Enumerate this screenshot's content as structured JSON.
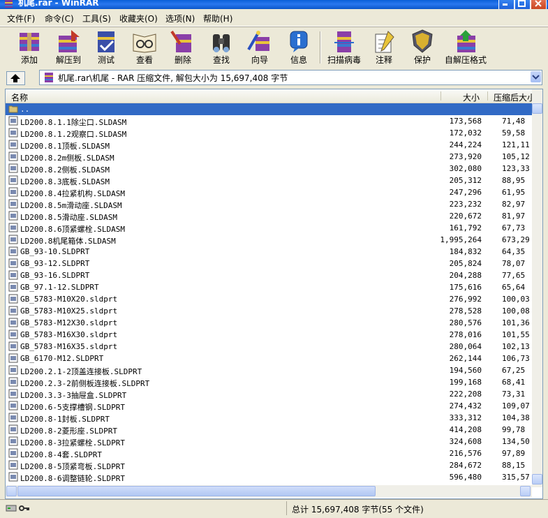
{
  "window": {
    "title": "机尾.rar - WinRAR"
  },
  "menu": [
    "文件(F)",
    "命令(C)",
    "工具(S)",
    "收藏夹(O)",
    "选项(N)",
    "帮助(H)"
  ],
  "toolbar": [
    {
      "label": "添加",
      "icon": "add-icon"
    },
    {
      "label": "解压到",
      "icon": "extract-icon"
    },
    {
      "label": "测试",
      "icon": "test-icon"
    },
    {
      "label": "查看",
      "icon": "view-icon"
    },
    {
      "label": "删除",
      "icon": "delete-icon"
    },
    {
      "label": "查找",
      "icon": "find-icon"
    },
    {
      "label": "向导",
      "icon": "wizard-icon"
    },
    {
      "label": "信息",
      "icon": "info-icon"
    },
    {
      "label": "扫描病毒",
      "icon": "virus-scan-icon"
    },
    {
      "label": "注释",
      "icon": "comment-icon"
    },
    {
      "label": "保护",
      "icon": "protect-icon"
    },
    {
      "label": "自解压格式",
      "icon": "sfx-icon"
    }
  ],
  "address": {
    "path": "机尾.rar\\机尾 - RAR 压缩文件, 解包大小为 15,697,408 字节"
  },
  "columns": {
    "name": "名称",
    "size": "大小",
    "packed": "压缩后大小"
  },
  "files": [
    {
      "name": "..",
      "size": "",
      "packed": ""
    },
    {
      "name": "LD200.8.1.1除尘口.SLDASM",
      "size": "173,568",
      "packed": "71,48"
    },
    {
      "name": "LD200.8.1.2观察口.SLDASM",
      "size": "172,032",
      "packed": "59,58"
    },
    {
      "name": "LD200.8.1顶板.SLDASM",
      "size": "244,224",
      "packed": "121,11"
    },
    {
      "name": "LD200.8.2m侧板.SLDASM",
      "size": "273,920",
      "packed": "105,12"
    },
    {
      "name": "LD200.8.2侧板.SLDASM",
      "size": "302,080",
      "packed": "123,33"
    },
    {
      "name": "LD200.8.3底板.SLDASM",
      "size": "205,312",
      "packed": "88,95"
    },
    {
      "name": "LD200.8.4拉紧机构.SLDASM",
      "size": "247,296",
      "packed": "61,95"
    },
    {
      "name": "LD200.8.5m滑动座.SLDASM",
      "size": "223,232",
      "packed": "82,97"
    },
    {
      "name": "LD200.8.5滑动座.SLDASM",
      "size": "220,672",
      "packed": "81,97"
    },
    {
      "name": "LD200.8.6顶紧螺栓.SLDASM",
      "size": "161,792",
      "packed": "67,73"
    },
    {
      "name": "LD200.8机尾箱体.SLDASM",
      "size": "1,995,264",
      "packed": "673,29"
    },
    {
      "name": "GB_93-10.SLDPRT",
      "size": "184,832",
      "packed": "64,35"
    },
    {
      "name": "GB_93-12.SLDPRT",
      "size": "205,824",
      "packed": "78,07"
    },
    {
      "name": "GB_93-16.SLDPRT",
      "size": "204,288",
      "packed": "77,65"
    },
    {
      "name": "GB_97.1-12.SLDPRT",
      "size": "175,616",
      "packed": "65,64"
    },
    {
      "name": "GB_5783-M10X20.sldprt",
      "size": "276,992",
      "packed": "100,03"
    },
    {
      "name": "GB_5783-M10X25.sldprt",
      "size": "278,528",
      "packed": "100,08"
    },
    {
      "name": "GB_5783-M12X30.sldprt",
      "size": "280,576",
      "packed": "101,36"
    },
    {
      "name": "GB_5783-M16X30.sldprt",
      "size": "278,016",
      "packed": "101,55"
    },
    {
      "name": "GB_5783-M16X35.sldprt",
      "size": "280,064",
      "packed": "102,13"
    },
    {
      "name": "GB_6170-M12.SLDPRT",
      "size": "262,144",
      "packed": "106,73"
    },
    {
      "name": "LD200.2.1-2顶盖连接板.SLDPRT",
      "size": "194,560",
      "packed": "67,25"
    },
    {
      "name": "LD200.2.3-2前侧板连接板.SLDPRT",
      "size": "199,168",
      "packed": "68,41"
    },
    {
      "name": "LD200.3.3-3抽屉盒.SLDPRT",
      "size": "222,208",
      "packed": "73,31"
    },
    {
      "name": "LD200.6-5支撑槽钢.SLDPRT",
      "size": "274,432",
      "packed": "109,07"
    },
    {
      "name": "LD200.8-1封板.SLDPRT",
      "size": "333,312",
      "packed": "104,38"
    },
    {
      "name": "LD200.8-2菱形座.SLDPRT",
      "size": "414,208",
      "packed": "99,78"
    },
    {
      "name": "LD200.8-3拉紧螺栓.SLDPRT",
      "size": "324,608",
      "packed": "134,50"
    },
    {
      "name": "LD200.8-4套.SLDPRT",
      "size": "216,576",
      "packed": "97,89"
    },
    {
      "name": "LD200.8-5顶紧弯板.SLDPRT",
      "size": "284,672",
      "packed": "88,15"
    },
    {
      "name": "LD200.8-6调整链轮.SLDPRT",
      "size": "596,480",
      "packed": "315,57"
    }
  ],
  "status": {
    "text": "总计 15,697,408 字节(55 个文件)"
  }
}
